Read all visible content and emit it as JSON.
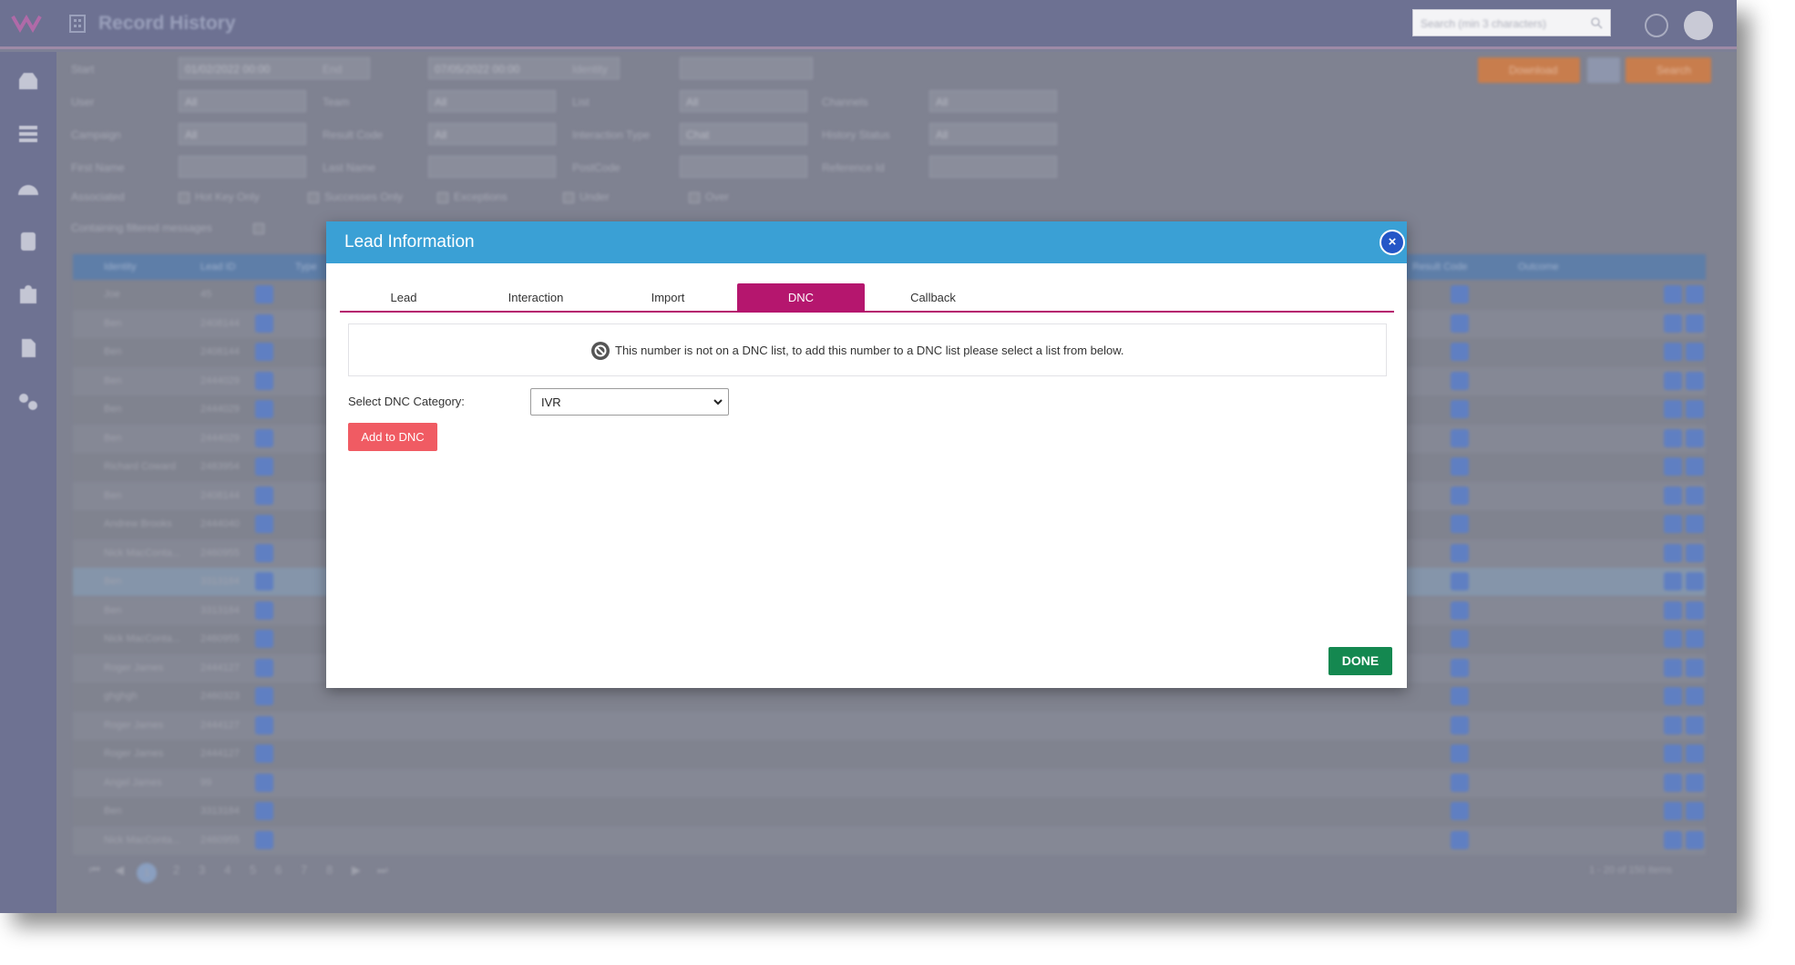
{
  "app": {
    "title": "Record History",
    "search_placeholder": "Search (min 3 characters)"
  },
  "sidebar": {
    "items": [
      {
        "icon": "inbox-icon"
      },
      {
        "icon": "list-icon"
      },
      {
        "icon": "dashboard-icon"
      },
      {
        "icon": "database-icon"
      },
      {
        "icon": "contacts-icon"
      },
      {
        "icon": "document-icon"
      },
      {
        "icon": "settings-icon"
      }
    ]
  },
  "filters": {
    "row1": [
      {
        "label": "Start",
        "value": "01/02/2022 00:00"
      },
      {
        "label": "End",
        "value": "07/05/2022 00:00"
      },
      {
        "label": "Identity",
        "value": ""
      }
    ],
    "row2": [
      {
        "label": "User",
        "value": "All"
      },
      {
        "label": "Team",
        "value": "All"
      },
      {
        "label": "List",
        "value": "All"
      },
      {
        "label": "Channels",
        "value": "All"
      }
    ],
    "row3": [
      {
        "label": "Campaign",
        "value": "All"
      },
      {
        "label": "Result Code",
        "value": "All"
      },
      {
        "label": "Interaction Type",
        "value": "Chat"
      },
      {
        "label": "History Status",
        "value": "All"
      }
    ],
    "row4": [
      {
        "label": "First Name",
        "value": ""
      },
      {
        "label": "Last Name",
        "value": ""
      },
      {
        "label": "PostCode",
        "value": ""
      },
      {
        "label": "Reference Id",
        "value": ""
      }
    ],
    "checkboxes": [
      "Hot Key Only",
      "Successes Only",
      "Exceptions",
      "Under",
      "Over"
    ],
    "associated_label": "Associated",
    "containing_label": "Containing filtered messages",
    "download_label": "Download",
    "search_label": "Search"
  },
  "grid": {
    "headers": [
      "Identity",
      "Lead ID",
      "Type",
      "Result Code",
      "Outcome"
    ],
    "rows": [
      {
        "identity": "Joe",
        "lead": "45"
      },
      {
        "identity": "Ben",
        "lead": "2408144"
      },
      {
        "identity": "Ben",
        "lead": "2408144"
      },
      {
        "identity": "Ben",
        "lead": "2444029"
      },
      {
        "identity": "Ben",
        "lead": "2444029"
      },
      {
        "identity": "Ben",
        "lead": "2444029"
      },
      {
        "identity": "Richard Coward",
        "lead": "2483954"
      },
      {
        "identity": "Ben",
        "lead": "2408144"
      },
      {
        "identity": "Andrew Brooks",
        "lead": "2444040"
      },
      {
        "identity": "Nick MacConta...",
        "lead": "2460955"
      },
      {
        "identity": "Ben",
        "lead": "3313184"
      },
      {
        "identity": "Ben",
        "lead": "3313184"
      },
      {
        "identity": "Nick MacConta...",
        "lead": "2460955"
      },
      {
        "identity": "Roger James",
        "lead": "2444127"
      },
      {
        "identity": "ghghgh",
        "lead": "2460323"
      },
      {
        "identity": "Roger James",
        "lead": "2444127"
      },
      {
        "identity": "Roger James",
        "lead": "2444127"
      },
      {
        "identity": "Angel James",
        "lead": "99"
      },
      {
        "identity": "Ben",
        "lead": "3313184"
      },
      {
        "identity": "Nick MacConta...",
        "lead": "2460955"
      }
    ],
    "pages": [
      "1",
      "2",
      "3",
      "4",
      "5",
      "6",
      "7",
      "8"
    ],
    "summary": "1 - 20 of 150 items"
  },
  "modal": {
    "title": "Lead Information",
    "close_symbol": "×",
    "tabs": [
      "Lead",
      "Interaction",
      "Import",
      "DNC",
      "Callback"
    ],
    "active_tab": "DNC",
    "notice": "This number is not on a DNC list, to add this number to a DNC list please select a list from below.",
    "select_label": "Select DNC Category:",
    "select_value": "IVR",
    "add_button": "Add to DNC",
    "done_button": "DONE"
  },
  "colors": {
    "modal_header": "#3aa0d5",
    "active_tab": "#b5166e",
    "add_button": "#f05b63",
    "done_button": "#148850",
    "close_button": "#2456c7"
  }
}
